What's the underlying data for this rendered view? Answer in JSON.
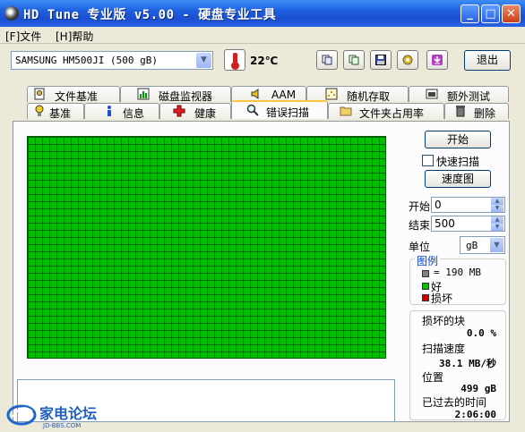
{
  "window": {
    "title": "HD Tune 专业版 v5.00 - 硬盘专业工具"
  },
  "menu": {
    "file": "[F]文件",
    "help": "[H]帮助"
  },
  "toolbar": {
    "drive": "SAMSUNG HM500JI (500 gB)",
    "temperature": "22℃",
    "exit_label": "退出"
  },
  "tabs_top": [
    "文件基准",
    "磁盘监视器",
    "AAM",
    "随机存取",
    "额外测试"
  ],
  "tabs_bottom": [
    "基准",
    "信息",
    "健康",
    "错误扫描",
    "文件夹占用率",
    "删除"
  ],
  "scan": {
    "start_button": "开始",
    "quick_scan_label": "快速扫描",
    "quick_scan_checked": false,
    "speed_map_button": "速度图",
    "start_label": "开始",
    "start_value": "0",
    "end_label": "结束",
    "end_value": "500",
    "unit_label": "单位",
    "unit_value": "gB",
    "legend_title": "图例",
    "legend_block": "= 190 MB",
    "legend_good": "好",
    "legend_bad": "损坏",
    "bad_blocks_label": "损坏的块",
    "bad_blocks_value": "0.0 %",
    "scan_speed_label": "扫描速度",
    "scan_speed_value": "38.1 MB/秒",
    "position_label": "位置",
    "position_value": "499 gB",
    "elapsed_label": "已过去的时间",
    "elapsed_value": "2:06:00"
  },
  "watermark": {
    "text": "家电论坛",
    "sub": "JD-BBS.COM"
  },
  "colors": {
    "good": "#00c000",
    "bad": "#d00000",
    "block": "#808080",
    "accent": "#0046d5"
  }
}
